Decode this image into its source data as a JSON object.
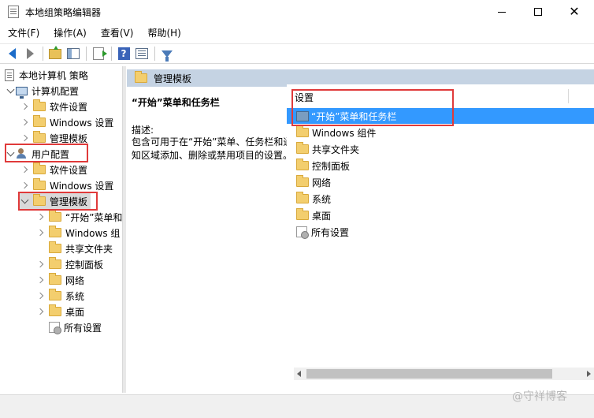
{
  "window": {
    "title": "本地组策略编辑器",
    "close_glyph": "✕"
  },
  "menu": [
    "文件(F)",
    "操作(A)",
    "查看(V)",
    "帮助(H)"
  ],
  "toolbar": {
    "icons": [
      "back-arrow-icon",
      "forward-arrow-icon",
      "up-folder-icon",
      "show-hide-tree-icon",
      "export-list-icon",
      "help-icon",
      "view-icon",
      "filter-icon"
    ],
    "help_glyph": "?"
  },
  "tree": {
    "root": "本地计算机 策略",
    "computer_config": "计算机配置",
    "computer_children": [
      "软件设置",
      "Windows 设置",
      "管理模板"
    ],
    "user_config": "用户配置",
    "user_children": [
      "软件设置",
      "Windows 设置",
      "管理模板"
    ],
    "admin_children": [
      "“开始”菜单和",
      "Windows 组",
      "共享文件夹",
      "控制面板",
      "网络",
      "系统",
      "桌面",
      "所有设置"
    ]
  },
  "main": {
    "header": "管理模板",
    "desc_title": "“开始”菜单和任务栏",
    "desc_label": "描述:",
    "desc_text": "包含可用于在“开始”菜单、任务栏和通知区域添加、删除或禁用项目的设置。"
  },
  "list": {
    "column_header": "设置",
    "items": [
      "“开始”菜单和任务栏",
      "Windows 组件",
      "共享文件夹",
      "控制面板",
      "网络",
      "系统",
      "桌面",
      "所有设置"
    ],
    "selected_index": 0
  },
  "watermark": "@守祥博客",
  "colors": {
    "selection": "#3399ff",
    "highlight_box": "#e03a3a",
    "header_band": "#c5d3e3",
    "folder": "#f3ce6e"
  }
}
